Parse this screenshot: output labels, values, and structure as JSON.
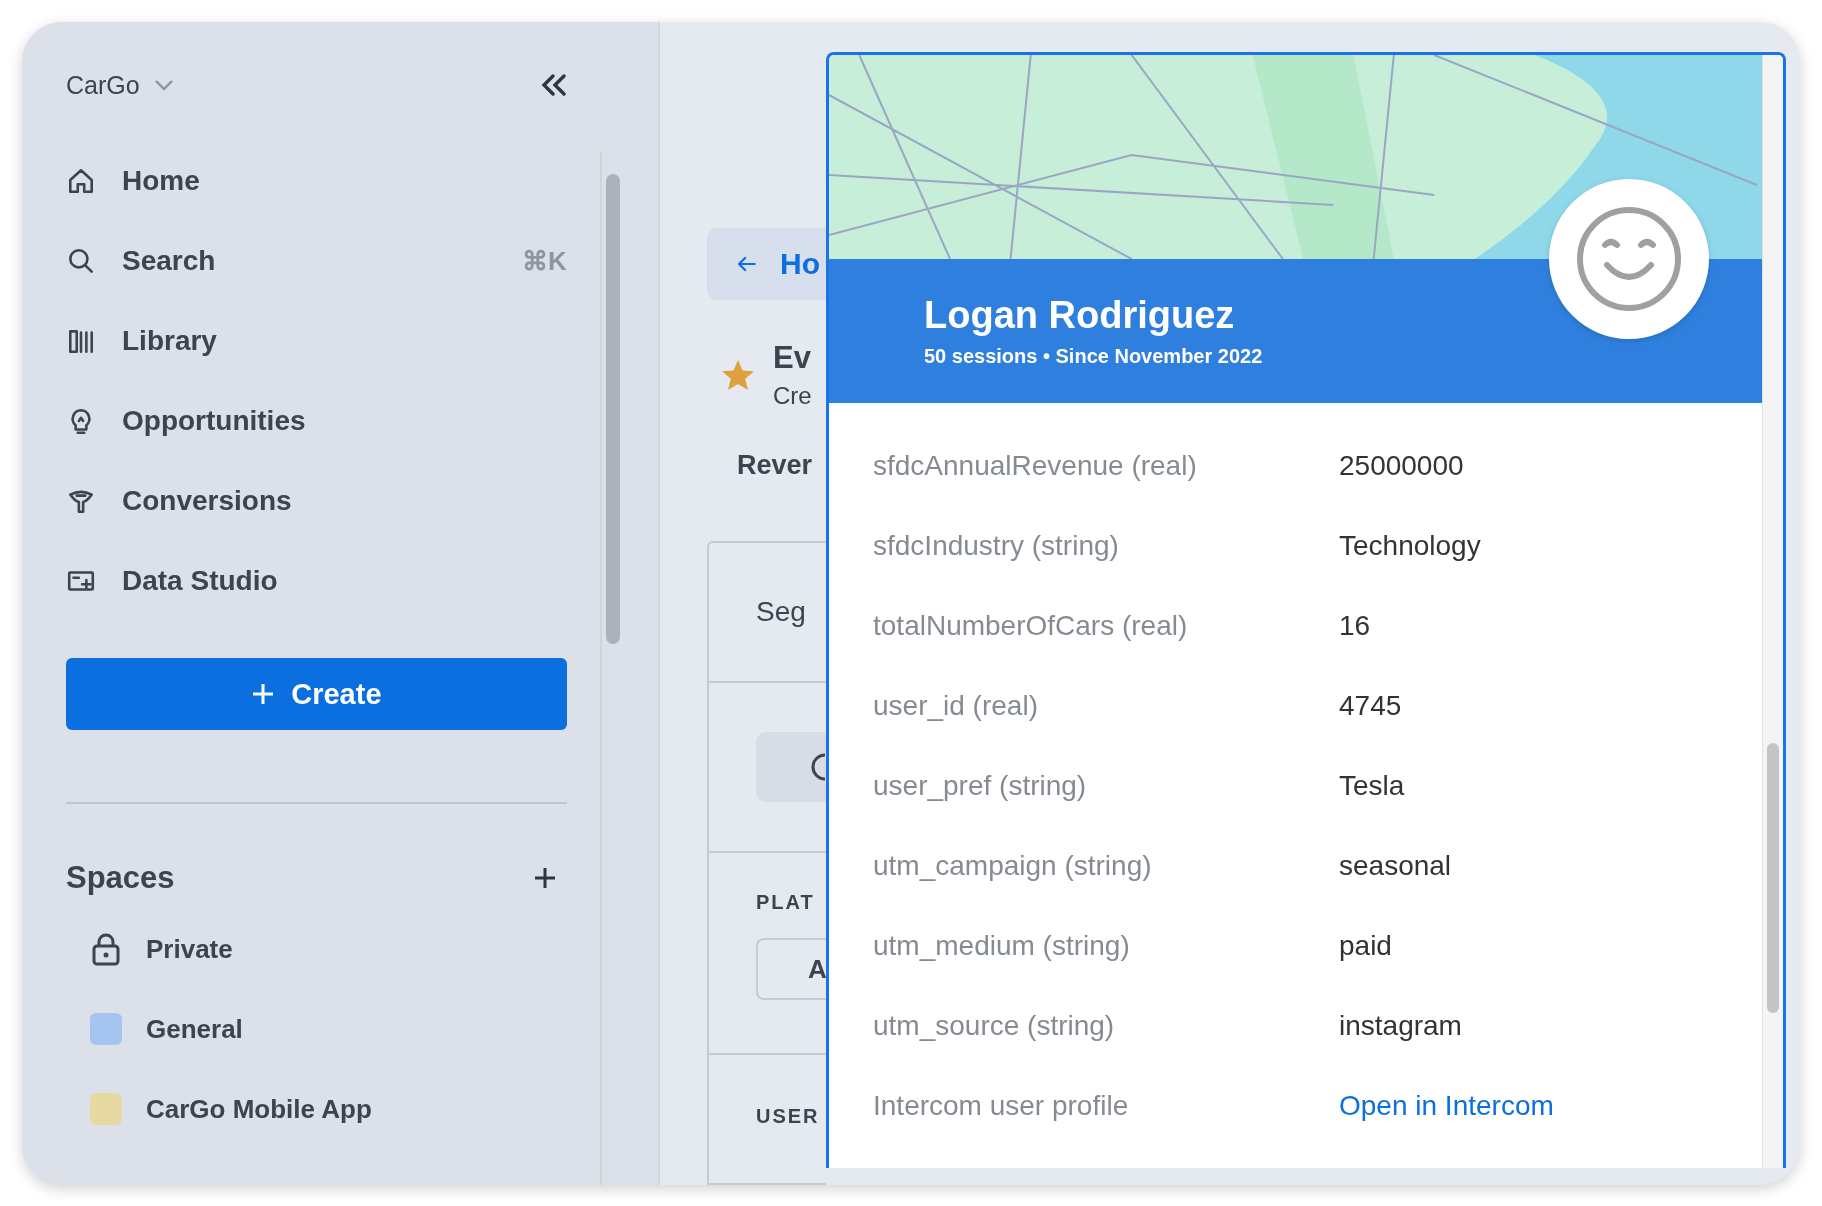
{
  "workspace": {
    "name": "CarGo"
  },
  "nav": [
    {
      "label": "Home"
    },
    {
      "label": "Search",
      "shortcut": "⌘K"
    },
    {
      "label": "Library"
    },
    {
      "label": "Opportunities"
    },
    {
      "label": "Conversions"
    },
    {
      "label": "Data Studio"
    }
  ],
  "create_button": {
    "label": "Create"
  },
  "spaces": {
    "title": "Spaces",
    "items": [
      {
        "label": "Private",
        "kind": "lock"
      },
      {
        "label": "General",
        "kind": "swatch",
        "color": "#a3c5f0"
      },
      {
        "label": "CarGo Mobile App",
        "kind": "swatch",
        "color": "#e6d9a2"
      }
    ]
  },
  "main": {
    "back_button": "Ho",
    "title": "Ev",
    "subtitle": "Cre",
    "tab": "Rever",
    "section": "Seg",
    "platform_label": "PLAT",
    "platform_button": "A",
    "user_label": "USER"
  },
  "profile": {
    "name": "Logan Rodriguez",
    "summary": "50 sessions • Since November 2022",
    "rows": [
      {
        "label": "sfdcAnnualRevenue (real)",
        "value": "25000000",
        "kind": "text"
      },
      {
        "label": "sfdcIndustry (string)",
        "value": "Technology",
        "kind": "text"
      },
      {
        "label": "totalNumberOfCars (real)",
        "value": "16",
        "kind": "text"
      },
      {
        "label": "user_id (real)",
        "value": "4745",
        "kind": "text"
      },
      {
        "label": "user_pref (string)",
        "value": "Tesla",
        "kind": "text"
      },
      {
        "label": "utm_campaign (string)",
        "value": "seasonal",
        "kind": "text"
      },
      {
        "label": "utm_medium (string)",
        "value": "paid",
        "kind": "text"
      },
      {
        "label": "utm_source (string)",
        "value": "instagram",
        "kind": "text"
      },
      {
        "label": "Intercom user profile",
        "value": "Open in Intercom",
        "kind": "link"
      }
    ]
  }
}
